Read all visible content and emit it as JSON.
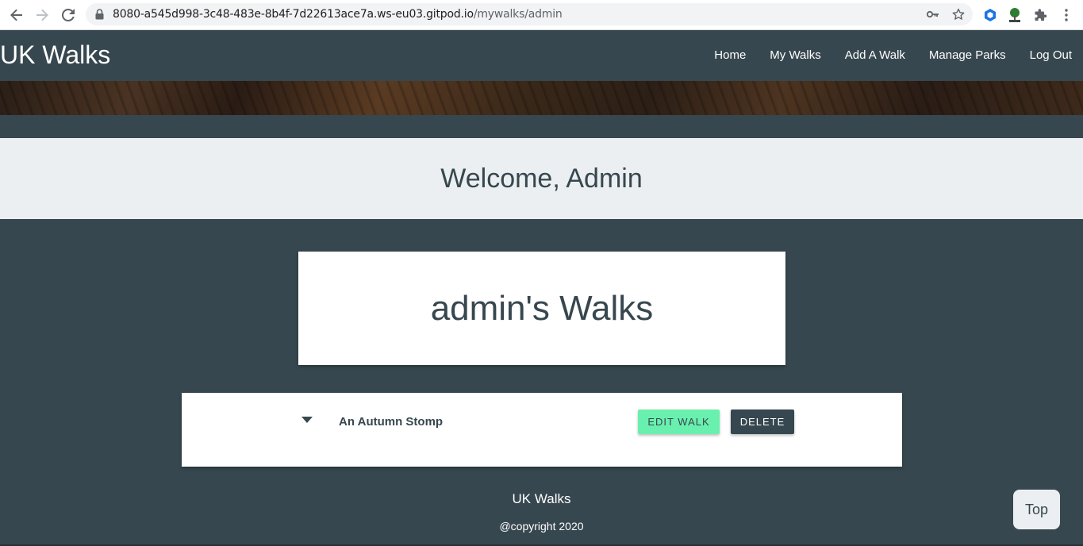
{
  "browser": {
    "url_host": "8080-a545d998-3c48-483e-8b4f-7d22613ace7a.ws-eu03.gitpod.io",
    "url_path": "/mywalks/admin",
    "icons": [
      "back-arrow-icon",
      "forward-arrow-icon",
      "reload-icon",
      "lock-icon",
      "key-icon",
      "star-icon",
      "extension-hex-icon",
      "extension-tree-icon",
      "puzzle-icon",
      "kebab-menu-icon"
    ]
  },
  "nav": {
    "brand": "UK Walks",
    "links": [
      {
        "label": "Home"
      },
      {
        "label": "My Walks"
      },
      {
        "label": "Add A Walk"
      },
      {
        "label": "Manage Parks"
      },
      {
        "label": "Log Out"
      }
    ]
  },
  "welcome": {
    "heading": "Welcome, Admin"
  },
  "walks_section": {
    "title": "admin's Walks",
    "items": [
      {
        "name": "An Autumn Stomp",
        "edit_label": "Edit Walk",
        "delete_label": "Delete",
        "toggle_icon": "caret-down-icon"
      }
    ]
  },
  "footer": {
    "title": "UK Walks",
    "copyright": "@copyright 2020"
  },
  "top_button": {
    "label": "Top"
  },
  "colors": {
    "primary": "#37474f",
    "light": "#eceff1",
    "accent": "#69f0ae"
  }
}
